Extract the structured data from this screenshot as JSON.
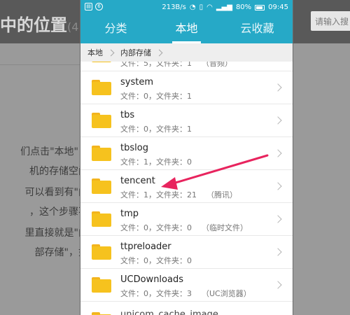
{
  "background": {
    "title": "中的位置",
    "title_suffix": "(4",
    "search_placeholder": "请输入搜",
    "lines_left": [
      "们点击\"本地\"，这",
      "机的存储空间，",
      "可以看到有\"内部",
      "，这个步骤不是",
      "里直接就是\"内部",
      "部存储\"，如下"
    ]
  },
  "status_bar": {
    "speed": "213B/s",
    "battery": "80%",
    "time": "09:45"
  },
  "tabs": [
    {
      "label": "分类",
      "active": false
    },
    {
      "label": "本地",
      "active": true
    },
    {
      "label": "云收藏",
      "active": false
    }
  ],
  "breadcrumb": [
    "本地",
    "内部存储"
  ],
  "files": [
    {
      "name": "",
      "meta": "文件：5，文件夹：1",
      "tag": "（音频）"
    },
    {
      "name": "system",
      "meta": "文件：0，文件夹：1",
      "tag": ""
    },
    {
      "name": "tbs",
      "meta": "文件：0，文件夹：1",
      "tag": ""
    },
    {
      "name": "tbslog",
      "meta": "文件：1，文件夹：0",
      "tag": ""
    },
    {
      "name": "tencent",
      "meta": "文件：1，文件夹：21",
      "tag": "（腾讯）"
    },
    {
      "name": "tmp",
      "meta": "文件：0，文件夹：0",
      "tag": "（临时文件）"
    },
    {
      "name": "ttpreloader",
      "meta": "文件：0，文件夹：0",
      "tag": ""
    },
    {
      "name": "UCDownloads",
      "meta": "文件：0，文件夹：3",
      "tag": "（UC浏览器）"
    }
  ],
  "partial_bottom_name": "unicom_cache_image",
  "colors": {
    "accent": "#26a9c7",
    "folder": "#f6c21e",
    "arrow": "#e8245e"
  }
}
